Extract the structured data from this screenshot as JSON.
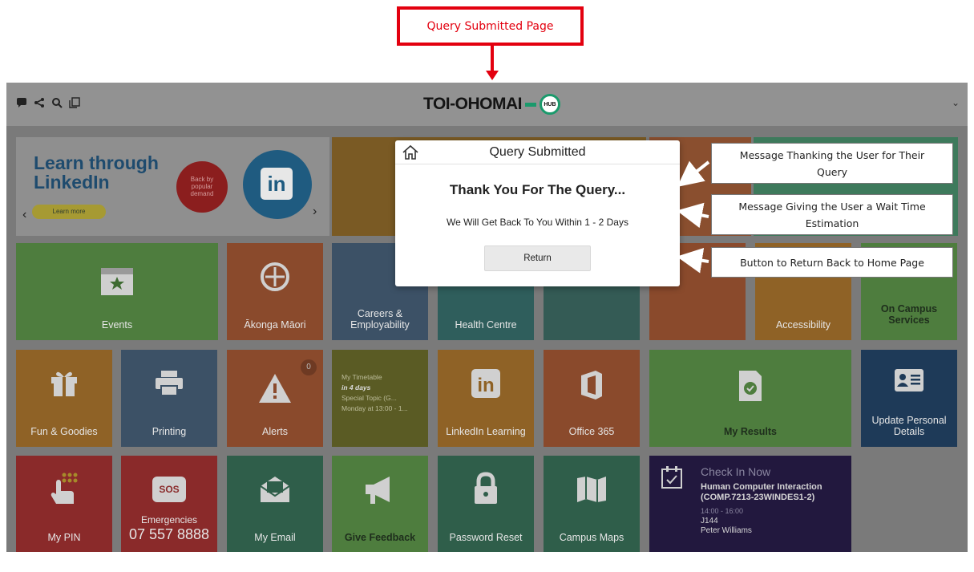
{
  "annotation": {
    "top_label": "Query Submitted Page"
  },
  "header": {
    "brand": "TOI-OHOMAI",
    "hub_badge": "HUB",
    "chevron": "⌄"
  },
  "banner": {
    "title_line1": "Learn through",
    "title_line2": "LinkedIn",
    "learn_more": "Learn more",
    "badge_line1": "Back by",
    "badge_line2": "popular",
    "badge_line3": "demand",
    "logo": "in"
  },
  "tiles": {
    "events": "Events",
    "akonga": "Ākonga Māori",
    "careers": "Careers & Employability",
    "health": "Health Centre",
    "accessibility": "Accessibility",
    "oncampus": "On Campus Services",
    "fun": "Fun & Goodies",
    "printing": "Printing",
    "alerts": "Alerts",
    "alerts_count": "0",
    "timetable_title": "My Timetable",
    "timetable_when": "in 4 days",
    "timetable_course": "Special Topic (G...",
    "timetable_time": "Monday at 13:00 - 1...",
    "linkedin_learning": "LinkedIn Learning",
    "office": "Office 365",
    "results": "My Results",
    "personal": "Update Personal Details",
    "pin": "My PIN",
    "emergencies": "Emergencies",
    "emergency_phone": "07 557 8888",
    "sos": "SOS",
    "email": "My Email",
    "feedback": "Give Feedback",
    "password": "Password Reset",
    "maps": "Campus Maps",
    "checkin_title": "Check In Now",
    "checkin_course": "Human Computer Interaction (COMP.7213-23WINDES1-2)",
    "checkin_time": "14:00 - 16:00",
    "checkin_room": "J144",
    "checkin_person": "Peter Williams"
  },
  "modal": {
    "title": "Query Submitted",
    "thanks": "Thank You For The Query...",
    "wait": "We Will Get Back To You Within 1 - 2 Days",
    "return_label": "Return"
  },
  "callouts": {
    "thanks": "Message Thanking the User for Their Query",
    "wait": "Message Giving the User a Wait Time Estimation",
    "return": "Button to Return Back to Home Page"
  },
  "colors": {
    "annotation_red": "#e3000f",
    "brand_green": "#1b9a6c"
  }
}
